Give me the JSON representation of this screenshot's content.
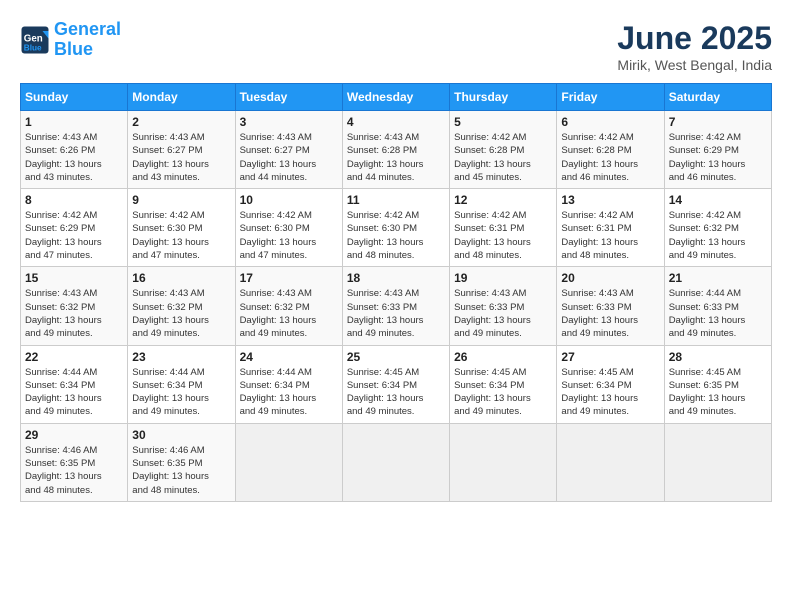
{
  "header": {
    "logo_line1": "General",
    "logo_line2": "Blue",
    "month": "June 2025",
    "location": "Mirik, West Bengal, India"
  },
  "weekdays": [
    "Sunday",
    "Monday",
    "Tuesday",
    "Wednesday",
    "Thursday",
    "Friday",
    "Saturday"
  ],
  "weeks": [
    [
      {
        "day": "1",
        "sunrise": "4:43 AM",
        "sunset": "6:26 PM",
        "daylight": "13 hours and 43 minutes."
      },
      {
        "day": "2",
        "sunrise": "4:43 AM",
        "sunset": "6:27 PM",
        "daylight": "13 hours and 43 minutes."
      },
      {
        "day": "3",
        "sunrise": "4:43 AM",
        "sunset": "6:27 PM",
        "daylight": "13 hours and 44 minutes."
      },
      {
        "day": "4",
        "sunrise": "4:43 AM",
        "sunset": "6:28 PM",
        "daylight": "13 hours and 44 minutes."
      },
      {
        "day": "5",
        "sunrise": "4:42 AM",
        "sunset": "6:28 PM",
        "daylight": "13 hours and 45 minutes."
      },
      {
        "day": "6",
        "sunrise": "4:42 AM",
        "sunset": "6:28 PM",
        "daylight": "13 hours and 46 minutes."
      },
      {
        "day": "7",
        "sunrise": "4:42 AM",
        "sunset": "6:29 PM",
        "daylight": "13 hours and 46 minutes."
      }
    ],
    [
      {
        "day": "8",
        "sunrise": "4:42 AM",
        "sunset": "6:29 PM",
        "daylight": "13 hours and 47 minutes."
      },
      {
        "day": "9",
        "sunrise": "4:42 AM",
        "sunset": "6:30 PM",
        "daylight": "13 hours and 47 minutes."
      },
      {
        "day": "10",
        "sunrise": "4:42 AM",
        "sunset": "6:30 PM",
        "daylight": "13 hours and 47 minutes."
      },
      {
        "day": "11",
        "sunrise": "4:42 AM",
        "sunset": "6:30 PM",
        "daylight": "13 hours and 48 minutes."
      },
      {
        "day": "12",
        "sunrise": "4:42 AM",
        "sunset": "6:31 PM",
        "daylight": "13 hours and 48 minutes."
      },
      {
        "day": "13",
        "sunrise": "4:42 AM",
        "sunset": "6:31 PM",
        "daylight": "13 hours and 48 minutes."
      },
      {
        "day": "14",
        "sunrise": "4:42 AM",
        "sunset": "6:32 PM",
        "daylight": "13 hours and 49 minutes."
      }
    ],
    [
      {
        "day": "15",
        "sunrise": "4:43 AM",
        "sunset": "6:32 PM",
        "daylight": "13 hours and 49 minutes."
      },
      {
        "day": "16",
        "sunrise": "4:43 AM",
        "sunset": "6:32 PM",
        "daylight": "13 hours and 49 minutes."
      },
      {
        "day": "17",
        "sunrise": "4:43 AM",
        "sunset": "6:32 PM",
        "daylight": "13 hours and 49 minutes."
      },
      {
        "day": "18",
        "sunrise": "4:43 AM",
        "sunset": "6:33 PM",
        "daylight": "13 hours and 49 minutes."
      },
      {
        "day": "19",
        "sunrise": "4:43 AM",
        "sunset": "6:33 PM",
        "daylight": "13 hours and 49 minutes."
      },
      {
        "day": "20",
        "sunrise": "4:43 AM",
        "sunset": "6:33 PM",
        "daylight": "13 hours and 49 minutes."
      },
      {
        "day": "21",
        "sunrise": "4:44 AM",
        "sunset": "6:33 PM",
        "daylight": "13 hours and 49 minutes."
      }
    ],
    [
      {
        "day": "22",
        "sunrise": "4:44 AM",
        "sunset": "6:34 PM",
        "daylight": "13 hours and 49 minutes."
      },
      {
        "day": "23",
        "sunrise": "4:44 AM",
        "sunset": "6:34 PM",
        "daylight": "13 hours and 49 minutes."
      },
      {
        "day": "24",
        "sunrise": "4:44 AM",
        "sunset": "6:34 PM",
        "daylight": "13 hours and 49 minutes."
      },
      {
        "day": "25",
        "sunrise": "4:45 AM",
        "sunset": "6:34 PM",
        "daylight": "13 hours and 49 minutes."
      },
      {
        "day": "26",
        "sunrise": "4:45 AM",
        "sunset": "6:34 PM",
        "daylight": "13 hours and 49 minutes."
      },
      {
        "day": "27",
        "sunrise": "4:45 AM",
        "sunset": "6:34 PM",
        "daylight": "13 hours and 49 minutes."
      },
      {
        "day": "28",
        "sunrise": "4:45 AM",
        "sunset": "6:35 PM",
        "daylight": "13 hours and 49 minutes."
      }
    ],
    [
      {
        "day": "29",
        "sunrise": "4:46 AM",
        "sunset": "6:35 PM",
        "daylight": "13 hours and 48 minutes."
      },
      {
        "day": "30",
        "sunrise": "4:46 AM",
        "sunset": "6:35 PM",
        "daylight": "13 hours and 48 minutes."
      },
      null,
      null,
      null,
      null,
      null
    ]
  ]
}
